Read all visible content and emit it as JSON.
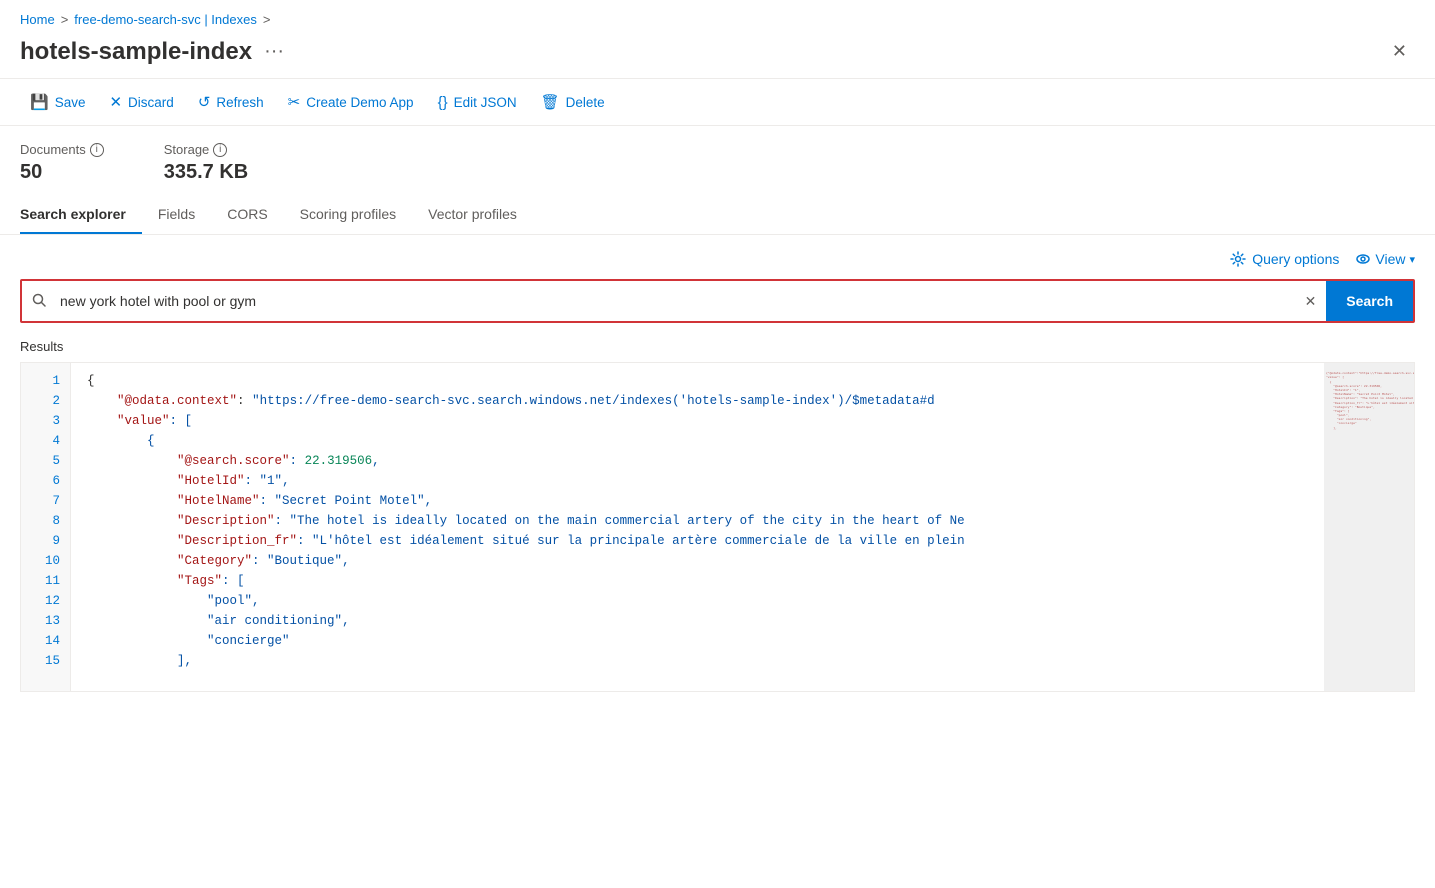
{
  "breadcrumb": {
    "home": "Home",
    "separator1": ">",
    "service": "free-demo-search-svc | Indexes",
    "separator2": ">"
  },
  "header": {
    "title": "hotels-sample-index",
    "dots": "···"
  },
  "toolbar": {
    "save": "Save",
    "discard": "Discard",
    "refresh": "Refresh",
    "create_demo": "Create Demo App",
    "edit_json": "Edit JSON",
    "delete": "Delete"
  },
  "stats": {
    "documents_label": "Documents",
    "documents_value": "50",
    "storage_label": "Storage",
    "storage_value": "335.7 KB"
  },
  "tabs": [
    {
      "label": "Search explorer",
      "active": true
    },
    {
      "label": "Fields",
      "active": false
    },
    {
      "label": "CORS",
      "active": false
    },
    {
      "label": "Scoring profiles",
      "active": false
    },
    {
      "label": "Vector profiles",
      "active": false
    }
  ],
  "search": {
    "query_options_label": "Query options",
    "view_label": "View",
    "placeholder": "new york hotel with pool or gym",
    "button_label": "Search"
  },
  "results": {
    "label": "Results",
    "code_lines": [
      {
        "num": "1",
        "content": "{"
      },
      {
        "num": "2",
        "content": "    \"@odata.context\": \"https://free-demo-search-svc.search.windows.net/indexes('hotels-sample-index')/$metadata#d"
      },
      {
        "num": "3",
        "content": "    \"value\": ["
      },
      {
        "num": "4",
        "content": "        {"
      },
      {
        "num": "5",
        "content": "            \"@search.score\": 22.319506,"
      },
      {
        "num": "6",
        "content": "            \"HotelId\": \"1\","
      },
      {
        "num": "7",
        "content": "            \"HotelName\": \"Secret Point Motel\","
      },
      {
        "num": "8",
        "content": "            \"Description\": \"The hotel is ideally located on the main commercial artery of the city in the heart of Ne"
      },
      {
        "num": "9",
        "content": "            \"Description_fr\": \"L'hôtel est idéalement situé sur la principale artère commerciale de la ville en plein"
      },
      {
        "num": "10",
        "content": "            \"Category\": \"Boutique\","
      },
      {
        "num": "11",
        "content": "            \"Tags\": ["
      },
      {
        "num": "12",
        "content": "                \"pool\","
      },
      {
        "num": "13",
        "content": "                \"air conditioning\","
      },
      {
        "num": "14",
        "content": "                \"concierge\""
      },
      {
        "num": "15",
        "content": "            ],"
      }
    ]
  }
}
